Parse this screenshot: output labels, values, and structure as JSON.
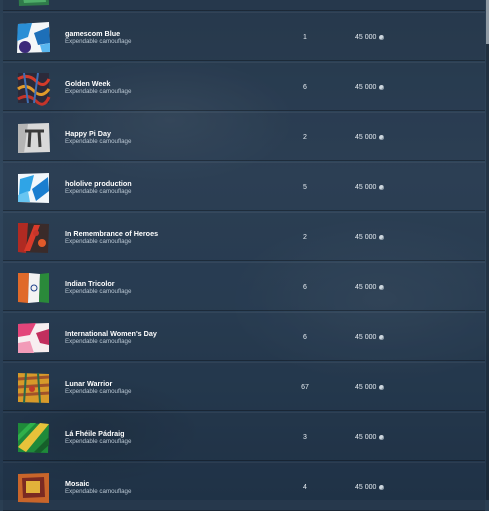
{
  "items": [
    {
      "name": "gamescom Blue",
      "type": "Expendable camouflage",
      "qty": "1",
      "price": "45 000",
      "icon": "gamescom-blue-camo-icon"
    },
    {
      "name": "Golden Week",
      "type": "Expendable camouflage",
      "qty": "6",
      "price": "45 000",
      "icon": "golden-week-camo-icon"
    },
    {
      "name": "Happy Pi Day",
      "type": "Expendable camouflage",
      "qty": "2",
      "price": "45 000",
      "icon": "happy-pi-day-camo-icon"
    },
    {
      "name": "hololive production",
      "type": "Expendable camouflage",
      "qty": "5",
      "price": "45 000",
      "icon": "hololive-camo-icon"
    },
    {
      "name": "In Remembrance of Heroes",
      "type": "Expendable camouflage",
      "qty": "2",
      "price": "45 000",
      "icon": "remembrance-camo-icon"
    },
    {
      "name": "Indian Tricolor",
      "type": "Expendable camouflage",
      "qty": "6",
      "price": "45 000",
      "icon": "indian-tricolor-camo-icon"
    },
    {
      "name": "International Women's Day",
      "type": "Expendable camouflage",
      "qty": "6",
      "price": "45 000",
      "icon": "womens-day-camo-icon"
    },
    {
      "name": "Lunar Warrior",
      "type": "Expendable camouflage",
      "qty": "67",
      "price": "45 000",
      "icon": "lunar-warrior-camo-icon"
    },
    {
      "name": "Lá Fhéile Pádraig",
      "type": "Expendable camouflage",
      "qty": "3",
      "price": "45 000",
      "icon": "la-fheile-padraig-camo-icon"
    },
    {
      "name": "Mosaic",
      "type": "Expendable camouflage",
      "qty": "4",
      "price": "45 000",
      "icon": "mosaic-camo-icon"
    }
  ],
  "currency_icon": "credits-coin-icon"
}
